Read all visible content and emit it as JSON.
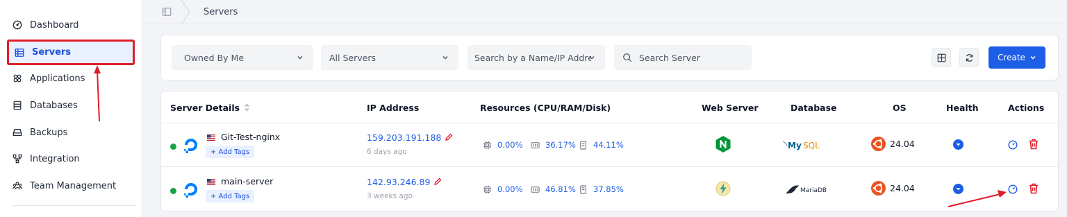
{
  "sidebar": {
    "items": [
      {
        "label": "Dashboard",
        "icon": "gauge-icon"
      },
      {
        "label": "Servers",
        "icon": "server-list-icon",
        "active": true
      },
      {
        "label": "Applications",
        "icon": "applications-icon"
      },
      {
        "label": "Databases",
        "icon": "database-icon"
      },
      {
        "label": "Backups",
        "icon": "backup-drive-icon"
      },
      {
        "label": "Integration",
        "icon": "integration-icon"
      },
      {
        "label": "Team Management",
        "icon": "team-icon"
      }
    ]
  },
  "breadcrumb": {
    "current": "Servers"
  },
  "filters": {
    "owner_select": "Owned By Me",
    "type_select": "All Servers",
    "search_by_select": "Search by a Name/IP Address",
    "search_placeholder": "Search Server",
    "create_label": "Create"
  },
  "table": {
    "headers": {
      "server_details": "Server Details",
      "ip_address": "IP Address",
      "resources": "Resources (CPU/RAM/Disk)",
      "web_server": "Web Server",
      "database": "Database",
      "os": "OS",
      "health": "Health",
      "actions": "Actions"
    },
    "rows": [
      {
        "name": "Git-Test-nginx",
        "add_tags": "+ Add Tags",
        "ip": "159.203.191.188",
        "created": "6 days ago",
        "cpu": "0.00%",
        "ram": "36.17%",
        "disk": "44.11%",
        "web_server": "nginx",
        "database": "MySQL",
        "os": "24.04"
      },
      {
        "name": "main-server",
        "add_tags": "+ Add Tags",
        "ip": "142.93.246.89",
        "created": "3 weeks ago",
        "cpu": "0.00%",
        "ram": "46.81%",
        "disk": "37.85%",
        "web_server": "openlitespeed",
        "database": "MariaDB",
        "os": "24.04"
      }
    ]
  },
  "colors": {
    "accent": "#1e5ee6",
    "annotation": "#e11d2a",
    "status_online": "#16a34a",
    "nginx": "#009639",
    "ubuntu": "#e95420"
  }
}
